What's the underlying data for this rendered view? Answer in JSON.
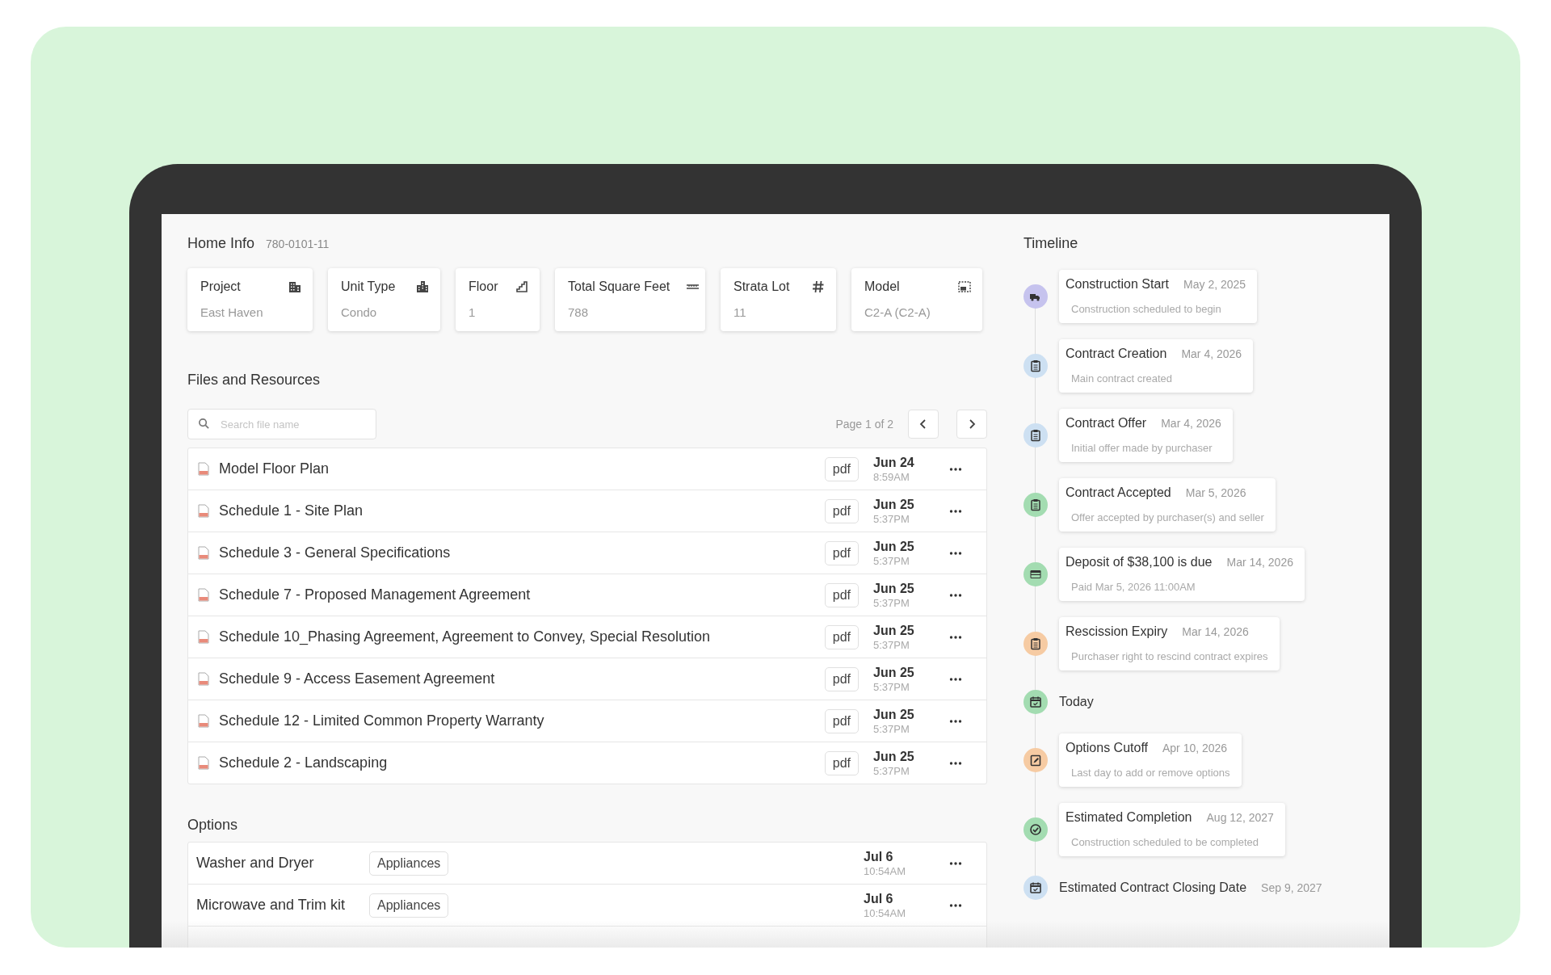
{
  "home_info": {
    "title": "Home Info",
    "code": "780-0101-11",
    "cards": [
      {
        "label": "Project",
        "value": "East Haven"
      },
      {
        "label": "Unit Type",
        "value": "Condo"
      },
      {
        "label": "Floor",
        "value": "1"
      },
      {
        "label": "Total Square Feet",
        "value": "788"
      },
      {
        "label": "Strata Lot",
        "value": "11"
      },
      {
        "label": "Model",
        "value": "C2-A (C2-A)"
      }
    ]
  },
  "files": {
    "title": "Files and Resources",
    "search": {
      "placeholder": "Search file name"
    },
    "page_label": "Page 1 of 2",
    "rows": [
      {
        "name": "Model Floor Plan",
        "type": "pdf",
        "date": "Jun 24",
        "time": "8:59AM"
      },
      {
        "name": "Schedule 1 - Site Plan",
        "type": "pdf",
        "date": "Jun 25",
        "time": "5:37PM"
      },
      {
        "name": "Schedule 3 - General Specifications",
        "type": "pdf",
        "date": "Jun 25",
        "time": "5:37PM"
      },
      {
        "name": "Schedule 7 - Proposed Management Agreement",
        "type": "pdf",
        "date": "Jun 25",
        "time": "5:37PM"
      },
      {
        "name": "Schedule 10_Phasing Agreement, Agreement to Convey, Special Resolution",
        "type": "pdf",
        "date": "Jun 25",
        "time": "5:37PM"
      },
      {
        "name": "Schedule 9 - Access Easement Agreement",
        "type": "pdf",
        "date": "Jun 25",
        "time": "5:37PM"
      },
      {
        "name": "Schedule 12 - Limited Common Property Warranty",
        "type": "pdf",
        "date": "Jun 25",
        "time": "5:37PM"
      },
      {
        "name": "Schedule 2 - Landscaping",
        "type": "pdf",
        "date": "Jun 25",
        "time": "5:37PM"
      }
    ]
  },
  "options": {
    "title": "Options",
    "rows": [
      {
        "name": "Washer and Dryer",
        "tag": "Appliances",
        "date": "Jul 6",
        "time": "10:54AM"
      },
      {
        "name": "Microwave and Trim kit",
        "tag": "Appliances",
        "date": "Jul 6",
        "time": "10:54AM"
      }
    ]
  },
  "timeline": {
    "title": "Timeline",
    "items": [
      {
        "kind": "card",
        "color": "#c6c3ee",
        "title": "Construction Start",
        "date": "May 2, 2025",
        "description": "Construction scheduled to begin"
      },
      {
        "kind": "card",
        "color": "#cde0f2",
        "title": "Contract Creation",
        "date": "Mar 4, 2026",
        "description": "Main contract created"
      },
      {
        "kind": "card",
        "color": "#cde0f2",
        "title": "Contract Offer",
        "date": "Mar 4, 2026",
        "description": "Initial offer made by purchaser"
      },
      {
        "kind": "card",
        "color": "#a3dcb1",
        "title": "Contract Accepted",
        "date": "Mar 5, 2026",
        "description": "Offer accepted by purchaser(s) and seller"
      },
      {
        "kind": "card",
        "color": "#a3dcb1",
        "title": "Deposit of $38,100 is due",
        "date": "Mar 14, 2026",
        "description": "Paid Mar 5, 2026 11:00AM"
      },
      {
        "kind": "card",
        "color": "#f6cba3",
        "title": "Rescission Expiry",
        "date": "Mar 14, 2026",
        "description": "Purchaser right to rescind contract expires"
      },
      {
        "kind": "plain",
        "color": "#a3dcb1",
        "title": "Today"
      },
      {
        "kind": "card",
        "color": "#f6cba3",
        "title": "Options Cutoff",
        "date": "Apr 10, 2026",
        "description": "Last day to add or remove options"
      },
      {
        "kind": "card",
        "color": "#a3dcb1",
        "title": "Estimated Completion",
        "date": "Aug 12, 2027",
        "description": "Construction scheduled to be completed"
      },
      {
        "kind": "plain",
        "color": "#cde0f2",
        "title": "Estimated Contract Closing Date",
        "date": "Sep 9, 2027"
      }
    ]
  }
}
